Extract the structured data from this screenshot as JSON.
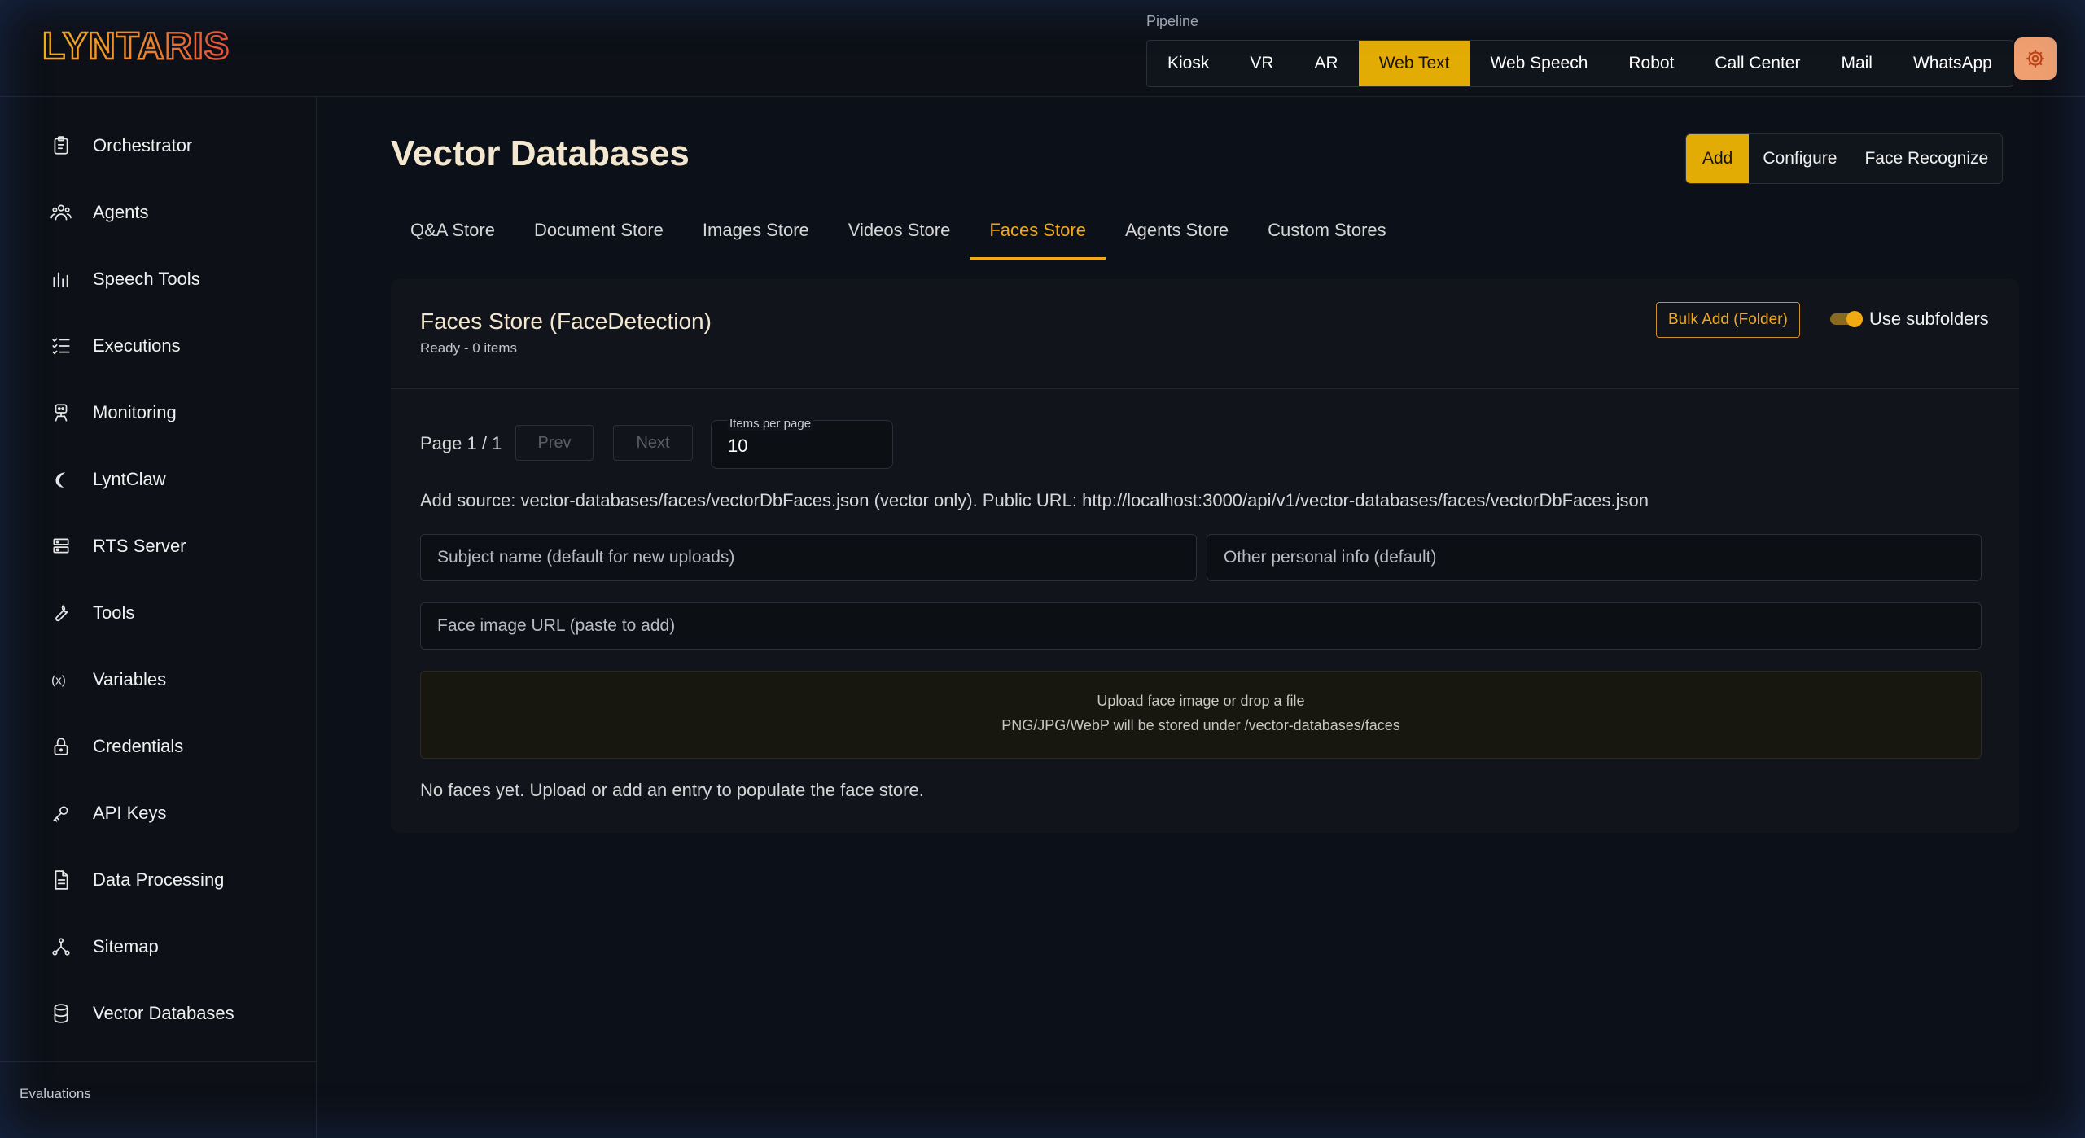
{
  "app": {
    "logo_text": "LYNTARIS"
  },
  "header": {
    "pipeline_label": "Pipeline",
    "pipelines": [
      {
        "label": "Kiosk",
        "active": false
      },
      {
        "label": "VR",
        "active": false
      },
      {
        "label": "AR",
        "active": false
      },
      {
        "label": "Web Text",
        "active": true
      },
      {
        "label": "Web Speech",
        "active": false
      },
      {
        "label": "Robot",
        "active": false
      },
      {
        "label": "Call Center",
        "active": false
      },
      {
        "label": "Mail",
        "active": false
      },
      {
        "label": "WhatsApp",
        "active": false
      }
    ],
    "settings_icon": "gear-icon"
  },
  "sidebar": {
    "items": [
      {
        "label": "Orchestrator",
        "icon": "clipboard-icon"
      },
      {
        "label": "Agents",
        "icon": "users-icon"
      },
      {
        "label": "Speech Tools",
        "icon": "bar-chart-icon"
      },
      {
        "label": "Executions",
        "icon": "list-check-icon"
      },
      {
        "label": "Monitoring",
        "icon": "robot-icon"
      },
      {
        "label": "LyntClaw",
        "icon": "claw-icon"
      },
      {
        "label": "RTS Server",
        "icon": "server-icon"
      },
      {
        "label": "Tools",
        "icon": "wrench-icon"
      },
      {
        "label": "Variables",
        "icon": "variable-icon"
      },
      {
        "label": "Credentials",
        "icon": "lock-icon"
      },
      {
        "label": "API Keys",
        "icon": "key-icon"
      },
      {
        "label": "Data Processing",
        "icon": "document-icon"
      },
      {
        "label": "Sitemap",
        "icon": "sitemap-icon"
      },
      {
        "label": "Vector Databases",
        "icon": "database-icon"
      }
    ],
    "section_label": "Evaluations"
  },
  "main": {
    "title": "Vector Databases",
    "actions": [
      {
        "label": "Add",
        "active": true
      },
      {
        "label": "Configure",
        "active": false
      },
      {
        "label": "Face Recognize",
        "active": false
      }
    ],
    "tabs": [
      {
        "label": "Q&A Store",
        "active": false
      },
      {
        "label": "Document Store",
        "active": false
      },
      {
        "label": "Images Store",
        "active": false
      },
      {
        "label": "Videos Store",
        "active": false
      },
      {
        "label": "Faces Store",
        "active": true
      },
      {
        "label": "Agents Store",
        "active": false
      },
      {
        "label": "Custom Stores",
        "active": false
      }
    ],
    "card": {
      "title": "Faces Store (FaceDetection)",
      "status": "Ready - 0 items",
      "bulk_add_label": "Bulk Add (Folder)",
      "subfolders_label": "Use subfolders",
      "subfolders_enabled": true,
      "page_info": "Page 1 / 1",
      "prev_label": "Prev",
      "next_label": "Next",
      "items_per_page_label": "Items per page",
      "items_per_page_value": "10",
      "source_line": "Add source: vector-databases/faces/vectorDbFaces.json (vector only). Public URL: http://localhost:3000/api/v1/vector-databases/faces/vectorDbFaces.json",
      "subject_placeholder": "Subject name (default for new uploads)",
      "other_info_placeholder": "Other personal info (default)",
      "url_placeholder": "Face image URL (paste to add)",
      "upload_line1": "Upload face image or drop a file",
      "upload_line2": "PNG/JPG/WebP will be stored under /vector-databases/faces",
      "empty_message": "No faces yet. Upload or add an entry to populate the face store."
    }
  },
  "colors": {
    "accent": "#e3ac05",
    "accent_text": "#f1a81a",
    "background": "#0c1018",
    "card": "#11151b"
  }
}
